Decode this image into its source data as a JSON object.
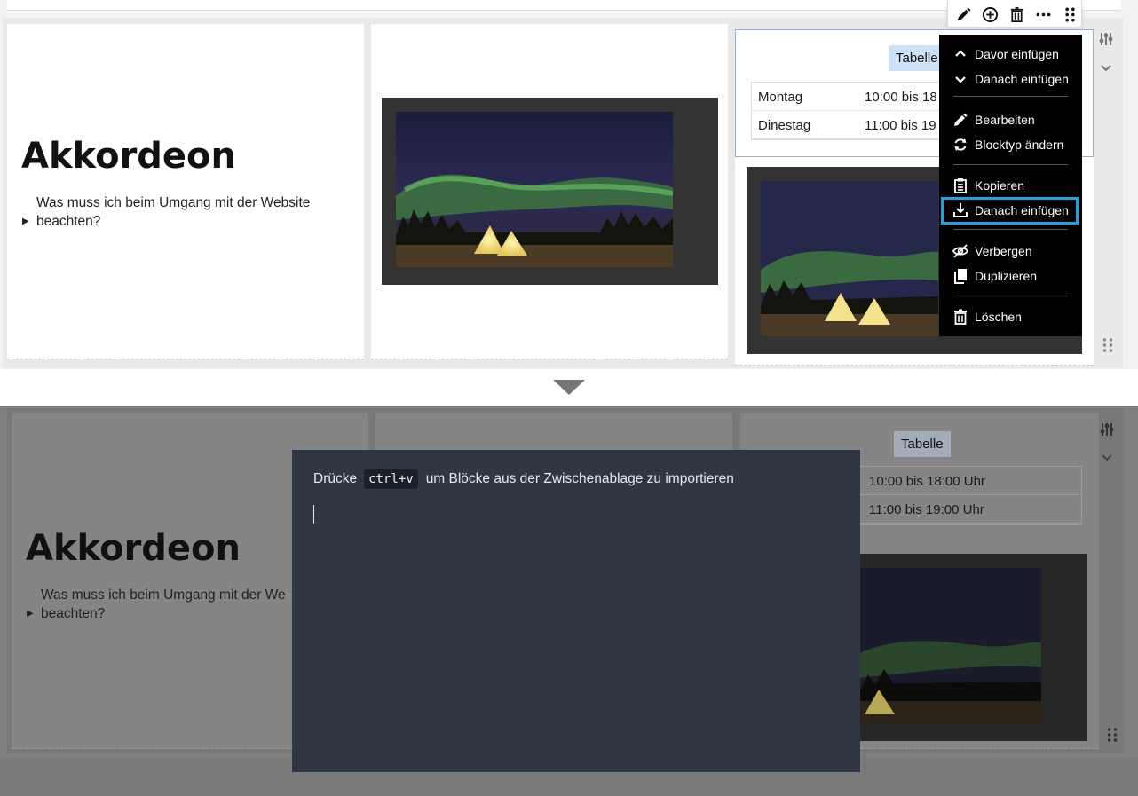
{
  "toolbar": {
    "edit_icon": "pencil-icon",
    "add_icon": "plus-circle-icon",
    "delete_icon": "trash-icon",
    "more_icon": "ellipsis-icon",
    "drag_icon": "grip-icon"
  },
  "top_blocks": {
    "accordion": {
      "heading": "Akkordeon",
      "question_line1": "Was muss ich beim Umgang mit der Website",
      "question_line2": "beachten?"
    },
    "table": {
      "caption": "Tabelle",
      "rows": [
        {
          "day": "Montag",
          "hours": "10:00 bis 18"
        },
        {
          "day": "Dinestag",
          "hours": "11:00 bis 19"
        }
      ]
    },
    "image_alt": "aurora-tipi-image"
  },
  "context_menu": {
    "items": [
      {
        "label": "Davor einfügen",
        "icon": "chevron-up-icon"
      },
      {
        "label": "Danach einfügen",
        "icon": "chevron-down-icon"
      },
      {
        "label": "Bearbeiten",
        "icon": "pencil-icon"
      },
      {
        "label": "Blocktyp ändern",
        "icon": "refresh-icon"
      },
      {
        "label": "Kopieren",
        "icon": "clipboard-icon"
      },
      {
        "label": "Danach einfügen",
        "icon": "download-icon",
        "highlighted": true
      },
      {
        "label": "Verbergen",
        "icon": "eye-off-icon"
      },
      {
        "label": "Duplizieren",
        "icon": "copy-icon"
      },
      {
        "label": "Löschen",
        "icon": "trash-icon"
      }
    ],
    "highlight_color": "#15a6e8"
  },
  "bottom_blocks": {
    "accordion": {
      "heading": "Akkordeon",
      "question_line1": "Was muss ich beim Umgang mit der We",
      "question_line2": "beachten?"
    },
    "table": {
      "caption": "Tabelle",
      "rows": [
        {
          "hours": "10:00 bis 18:00 Uhr"
        },
        {
          "hours": "11:00 bis 19:00 Uhr"
        }
      ]
    }
  },
  "paste_modal": {
    "prefix": "Drücke",
    "shortcut": "ctrl+v",
    "suffix": "um Blöcke aus der Zwischenablage zu importieren"
  }
}
